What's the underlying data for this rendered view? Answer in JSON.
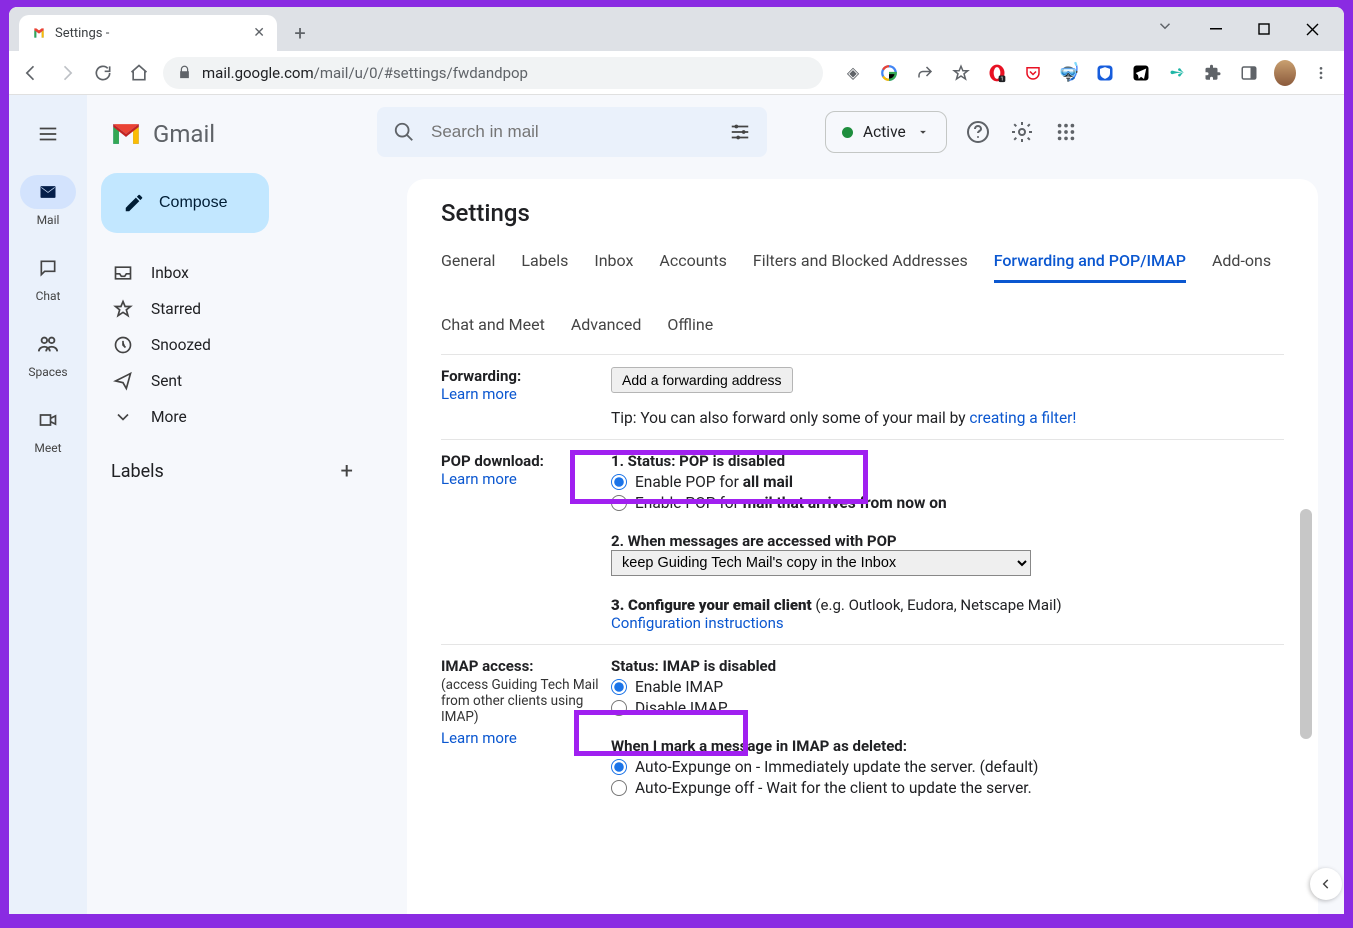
{
  "browser": {
    "tab_title": "Settings -",
    "url_display_prefix": "mail.google.com",
    "url_display_suffix": "/mail/u/0/#settings/fwdandpop"
  },
  "gmail": {
    "brand": "Gmail",
    "search_placeholder": "Search in mail",
    "status_label": "Active",
    "compose": "Compose",
    "rail": {
      "mail": "Mail",
      "chat": "Chat",
      "spaces": "Spaces",
      "meet": "Meet"
    },
    "nav": {
      "inbox": "Inbox",
      "starred": "Starred",
      "snoozed": "Snoozed",
      "sent": "Sent",
      "more": "More"
    },
    "labels_header": "Labels"
  },
  "settings": {
    "heading": "Settings",
    "tabs": [
      "General",
      "Labels",
      "Inbox",
      "Accounts",
      "Filters and Blocked Addresses",
      "Forwarding and POP/IMAP",
      "Add-ons",
      "Chat and Meet",
      "Advanced",
      "Offline"
    ],
    "active_tab_index": 5,
    "forwarding": {
      "title": "Forwarding:",
      "learn": "Learn more",
      "add_btn": "Add a forwarding address",
      "tip_prefix": "Tip: You can also forward only some of your mail by ",
      "tip_link": "creating a filter!"
    },
    "pop": {
      "title": "POP download:",
      "learn": "Learn more",
      "status": "1. Status: POP is disabled",
      "opt_all_pre": "Enable POP for ",
      "opt_all_bold": "all mail",
      "opt_new_pre": "Enable POP for ",
      "opt_new_bold": "mail that arrives from now on",
      "step2": "2. When messages are accessed with POP",
      "select_value": "keep Guiding Tech Mail's copy in the Inbox",
      "step3_pre": "3. Configure your email client ",
      "step3_paren": "(e.g. Outlook, Eudora, Netscape Mail)",
      "config_link": "Configuration instructions"
    },
    "imap": {
      "title": "IMAP access:",
      "sub": "(access Guiding Tech Mail from other clients using IMAP)",
      "learn": "Learn more",
      "status": "Status: IMAP is disabled",
      "enable": "Enable IMAP",
      "disable": "Disable IMAP",
      "deleted_heading": "When I mark a message in IMAP as deleted:",
      "expunge_on": "Auto-Expunge on - Immediately update the server. (default)",
      "expunge_off": "Auto-Expunge off - Wait for the client to update the server."
    }
  }
}
